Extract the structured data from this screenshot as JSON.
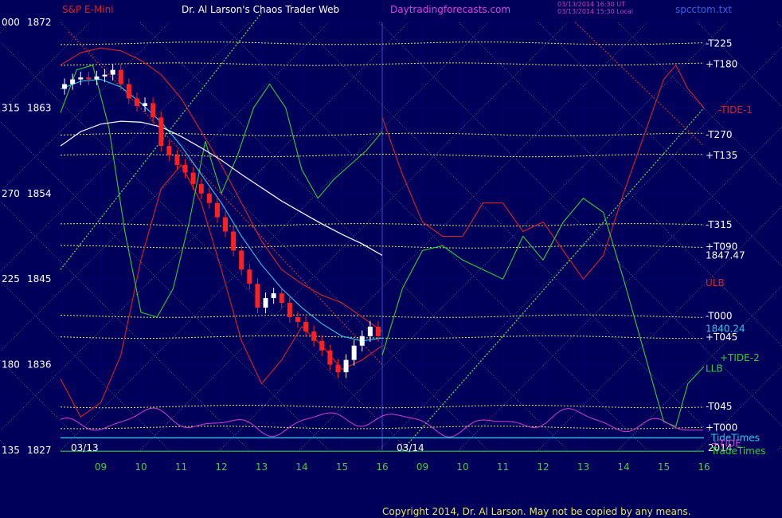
{
  "header": {
    "title_left": "S&P E-Mini",
    "title_center": "Dr. Al Larson's Chaos Trader Web",
    "title_site": "Daytradingforecasts.com",
    "timestamp_1": "03/13/2014 16:30 UT",
    "timestamp_2": "03/13/2014 15:30 Local",
    "file": "spcctom.txt"
  },
  "footer": {
    "copyright": "Copyright 2014, Dr. Al Larson. May not be copied by any means."
  },
  "colors": {
    "background": "#00005a",
    "grid": "#00006f",
    "price_axis": "#ffffff",
    "time_axis": "#4cc84c",
    "level": "#e8e85a",
    "red_band": "#e02020",
    "green_band": "#30d030",
    "cyan_line": "#30c8e8",
    "white_curve": "#f0f0f0",
    "magenta_cycle": "#d040d0",
    "diagonal": "#aaaaaa",
    "green_angle": "#50d050"
  },
  "chart_data": {
    "type": "line",
    "title": "S&P E-Mini",
    "price_scale": {
      "ylim": [
        1827,
        1872
      ],
      "ticks": [
        {
          "code": "000",
          "price": "1872",
          "value": 1872
        },
        {
          "code": "315",
          "price": "1863",
          "value": 1863
        },
        {
          "code": "270",
          "price": "1854",
          "value": 1854
        },
        {
          "code": "225",
          "price": "1845",
          "value": 1845
        },
        {
          "code": "180",
          "price": "1836",
          "value": 1836
        },
        {
          "code": "135",
          "price": "1827",
          "value": 1827
        }
      ]
    },
    "time_scale": {
      "xlim": [
        8.0,
        24.0
      ],
      "day_split": 16.0,
      "ticks": [
        {
          "label": "09",
          "x": 9
        },
        {
          "label": "10",
          "x": 10
        },
        {
          "label": "11",
          "x": 11
        },
        {
          "label": "12",
          "x": 12
        },
        {
          "label": "13",
          "x": 13
        },
        {
          "label": "14",
          "x": 14
        },
        {
          "label": "15",
          "x": 15
        },
        {
          "label": "16",
          "x": 16
        },
        {
          "label": "09",
          "x": 17
        },
        {
          "label": "10",
          "x": 18
        },
        {
          "label": "11",
          "x": 19
        },
        {
          "label": "12",
          "x": 20
        },
        {
          "label": "13",
          "x": 21
        },
        {
          "label": "14",
          "x": 22
        },
        {
          "label": "15",
          "x": 23
        },
        {
          "label": "16",
          "x": 24
        }
      ],
      "date_labels": [
        {
          "label": "03/13",
          "x": 8.6
        },
        {
          "label": "03/14",
          "x": 16.7
        },
        {
          "label": "2014",
          "x": 24.4
        }
      ]
    },
    "levels": [
      {
        "label": "-T225",
        "value": 1869.8
      },
      {
        "label": "+T180",
        "value": 1867.6
      },
      {
        "label": "-T270",
        "value": 1860.2
      },
      {
        "label": "+T135",
        "value": 1858.0
      },
      {
        "label": "-T315",
        "value": 1850.7
      },
      {
        "label": "+T090",
        "value": 1848.4
      },
      {
        "label": "-T000",
        "value": 1841.1
      },
      {
        "label": "+T045",
        "value": 1838.9
      },
      {
        "label": "-T045",
        "value": 1831.6
      },
      {
        "label": "+T000",
        "value": 1829.4
      }
    ],
    "right_annotations": [
      {
        "label": "-TIDE-1",
        "value": 1862.8,
        "color": "#e02020"
      },
      {
        "label": "1847.47",
        "value": 1847.47,
        "color": "#ffffff"
      },
      {
        "label": "ULB",
        "value": 1844.6,
        "color": "#e02020"
      },
      {
        "label": "1840.24",
        "value": 1839.8,
        "color": "#30c8e8"
      },
      {
        "label": "+TIDE-2",
        "value": 1836.7,
        "color": "#30d030"
      },
      {
        "label": "LLB",
        "value": 1835.6,
        "color": "#30d030"
      },
      {
        "label": "TideTimes",
        "value": 1828.3,
        "color": "#30c8e8"
      },
      {
        "label": "+TIDE",
        "value": 1827.7,
        "color": "#d040d0"
      },
      {
        "label": "TradeTimes",
        "value": 1826.9,
        "color": "#30d030"
      }
    ],
    "series": [
      {
        "role": "price",
        "color": "#ffffff",
        "x": [
          8.0,
          8.2,
          8.4,
          8.6,
          8.8,
          9.0,
          9.2,
          9.4,
          9.6,
          9.8,
          10.0,
          10.2,
          10.4,
          10.6,
          10.8,
          11.0,
          11.2,
          11.4,
          11.6,
          11.8,
          12.0,
          12.2,
          12.4,
          12.6,
          12.8,
          13.0,
          13.2,
          13.4,
          13.6,
          13.8,
          14.0,
          14.2,
          14.4,
          14.6,
          14.8,
          15.0,
          15.2,
          15.4,
          15.6,
          15.8,
          16.0
        ],
        "values": [
          1865.0,
          1865.5,
          1866.0,
          1866.2,
          1866.0,
          1866.3,
          1866.5,
          1867.0,
          1865.5,
          1864.0,
          1863.2,
          1863.5,
          1862.0,
          1859.0,
          1858.0,
          1857.0,
          1856.2,
          1855.0,
          1854.0,
          1853.0,
          1851.5,
          1850.0,
          1848.0,
          1846.0,
          1844.5,
          1842.0,
          1843.0,
          1843.5,
          1842.5,
          1841.0,
          1840.5,
          1839.5,
          1838.5,
          1837.5,
          1836.0,
          1835.2,
          1836.5,
          1838.0,
          1839.0,
          1840.0,
          1839.0
        ]
      },
      {
        "role": "red-band-upper",
        "color": "#e02020",
        "x": [
          8.0,
          8.5,
          9.0,
          9.5,
          10.0,
          10.5,
          11.0,
          11.5,
          12.0,
          12.5,
          13.0,
          13.5,
          14.0,
          14.5,
          15.0,
          15.5,
          16.0
        ],
        "values": [
          1867.5,
          1868.8,
          1869.3,
          1869.0,
          1868.0,
          1866.5,
          1864.0,
          1860.5,
          1857.0,
          1853.0,
          1849.0,
          1846.0,
          1844.5,
          1843.3,
          1842.5,
          1841.0,
          1839.5
        ]
      },
      {
        "role": "red-band-lower",
        "color": "#e02020",
        "x": [
          8.0,
          8.5,
          9.0,
          9.5,
          10.0,
          10.5,
          11.0,
          11.5,
          12.0,
          12.5,
          13.0,
          13.5,
          14.0,
          14.5,
          15.0,
          15.5,
          16.0
        ],
        "values": [
          1834.5,
          1830.5,
          1832.0,
          1837.0,
          1847.0,
          1854.5,
          1857.0,
          1853.0,
          1846.0,
          1838.5,
          1834.0,
          1836.5,
          1840.0,
          1838.0,
          1835.5,
          1836.5,
          1838.0
        ]
      },
      {
        "role": "red-forecast",
        "color": "#e02020",
        "x": [
          16.0,
          16.5,
          17.0,
          17.5,
          18.0,
          18.5,
          19.0,
          19.5,
          20.0,
          20.5,
          21.0,
          21.5,
          22.0,
          22.5,
          23.0,
          23.3,
          23.6,
          24.0
        ],
        "values": [
          1862.0,
          1856.0,
          1851.0,
          1849.5,
          1849.5,
          1853.0,
          1853.0,
          1850.0,
          1851.0,
          1848.0,
          1845.0,
          1847.5,
          1854.0,
          1860.0,
          1866.0,
          1867.5,
          1865.0,
          1863.0
        ]
      },
      {
        "role": "green-band",
        "color": "#30d030",
        "x": [
          8.0,
          8.4,
          8.8,
          9.2,
          9.6,
          10.0,
          10.4,
          10.8,
          11.2,
          11.6,
          12.0,
          12.4,
          12.8,
          13.2,
          13.6,
          14.0,
          14.4,
          14.8,
          15.2,
          15.6,
          16.0
        ],
        "values": [
          1862.5,
          1867.0,
          1867.5,
          1861.0,
          1850.0,
          1841.5,
          1841.0,
          1844.0,
          1851.0,
          1859.5,
          1854.0,
          1858.0,
          1863.0,
          1865.5,
          1863.0,
          1856.5,
          1853.5,
          1855.5,
          1857.0,
          1858.5,
          1860.5
        ]
      },
      {
        "role": "green-forecast",
        "color": "#30d030",
        "x": [
          16.0,
          16.5,
          17.0,
          17.5,
          18.0,
          18.5,
          19.0,
          19.5,
          20.0,
          20.5,
          21.0,
          21.5,
          22.0,
          22.5,
          23.0,
          23.3,
          23.6,
          24.0
        ],
        "values": [
          1837.0,
          1844.0,
          1848.0,
          1848.5,
          1847.0,
          1846.0,
          1845.0,
          1849.5,
          1847.0,
          1851.0,
          1853.5,
          1852.0,
          1845.0,
          1837.5,
          1830.0,
          1829.5,
          1834.0,
          1835.8
        ]
      },
      {
        "role": "cyan-average",
        "color": "#30c8e8",
        "x": [
          8.0,
          8.5,
          9.0,
          9.5,
          10.0,
          10.5,
          11.0,
          11.5,
          12.0,
          12.5,
          13.0,
          13.5,
          14.0,
          14.5,
          15.0,
          15.5,
          16.0
        ],
        "values": [
          1865.0,
          1865.8,
          1866.0,
          1865.2,
          1863.5,
          1861.5,
          1859.0,
          1856.0,
          1853.0,
          1849.5,
          1846.5,
          1844.0,
          1842.0,
          1840.3,
          1839.0,
          1838.5,
          1838.8
        ]
      },
      {
        "role": "white-curve",
        "color": "#f0f0f0",
        "x": [
          8.0,
          8.5,
          9.0,
          9.5,
          10.0,
          10.5,
          11.0,
          11.5,
          12.0,
          12.5,
          13.0,
          13.5,
          14.0,
          14.5,
          15.0,
          15.5,
          16.0
        ],
        "values": [
          1859.0,
          1860.5,
          1861.3,
          1861.6,
          1861.5,
          1861.0,
          1860.0,
          1858.8,
          1857.5,
          1856.0,
          1854.6,
          1853.2,
          1852.0,
          1850.8,
          1849.7,
          1848.7,
          1847.5
        ]
      }
    ]
  }
}
